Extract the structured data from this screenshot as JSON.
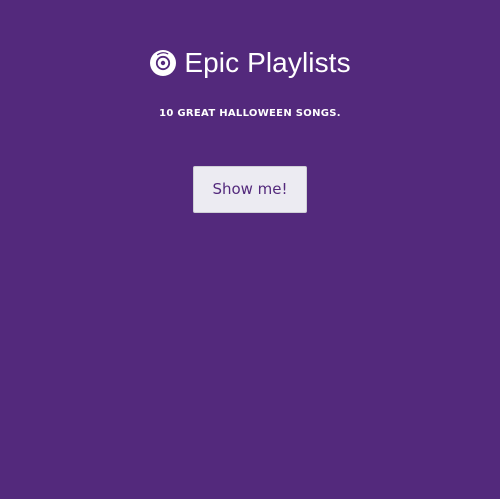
{
  "app": {
    "title": "Epic Playlists",
    "subtitle": "10 GREAT HALLOWEEN SONGS.",
    "cta_label": "Show me!",
    "logo_icon": "vinyl-disc-icon"
  },
  "colors": {
    "background": "#53297c",
    "text": "#ffffff",
    "button_bg": "#ecebf2",
    "button_text": "#53297c"
  }
}
